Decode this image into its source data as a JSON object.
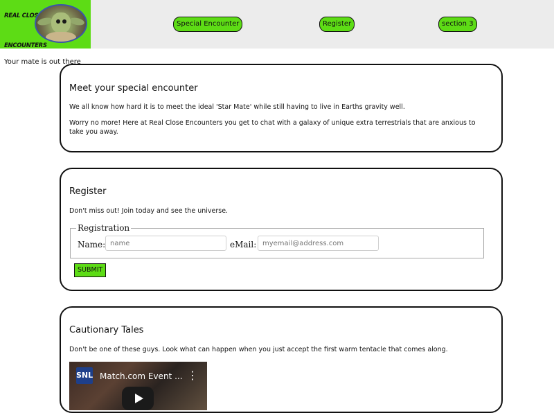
{
  "header": {
    "brand_line1": "REAL CLOSE",
    "brand_line2": "ENCOUNTERS",
    "logo_icon": "alien-baby-logo",
    "nav": [
      {
        "label": "Special Encounter"
      },
      {
        "label": "Register"
      },
      {
        "label": "section 3"
      }
    ],
    "accent_color": "#5ddc15"
  },
  "tagline": "Your mate is out there",
  "sections": {
    "intro": {
      "title": "Meet your special encounter",
      "para1": "We all know how hard it is to meet the ideal 'Star Mate' while still having to live in Earths gravity well.",
      "para2": "Worry no more! Here at Real Close Encounters you get to chat with a galaxy of unique extra terrestrials that are anxious to take you away."
    },
    "register": {
      "title": "Register",
      "para1": "Don't miss out! Join today and see the universe.",
      "legend": "Registration",
      "name_label": "Name:",
      "name_placeholder": "name",
      "email_label": "eMail:",
      "email_placeholder": "myemail@address.com",
      "submit_label": "SUBMIT"
    },
    "tales": {
      "title": "Cautionary Tales",
      "para1": "Don't be one of these guys. Look what can happen when you just accept the first warm tentacle that comes along.",
      "video": {
        "channel_logo": "SNL",
        "title": "Match.com Event ...",
        "menu_icon": "more-vert-icon",
        "play_icon": "play-icon"
      }
    }
  }
}
